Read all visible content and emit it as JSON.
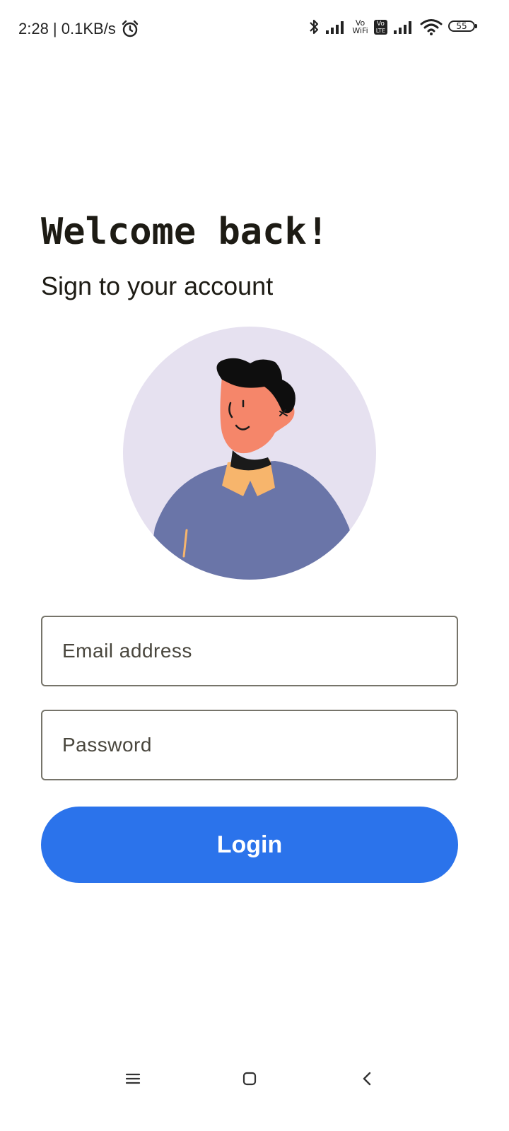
{
  "status_bar": {
    "time_speed": "2:28 | 0.1KB/s",
    "volte_wifi_top": "Vo",
    "volte_wifi_bottom": "WiFi",
    "volte_lte_top": "Vo",
    "volte_lte_bottom": "LTE",
    "battery_level": "55",
    "icons": [
      "alarm-icon",
      "bluetooth-icon",
      "signal-icon",
      "vowifi-icon",
      "volte-icon",
      "signal-icon",
      "wifi-icon",
      "battery-icon"
    ]
  },
  "login": {
    "title": "Welcome back!",
    "subtitle": "Sign to your account",
    "avatar_icon": "user-avatar-illustration",
    "email_placeholder": "Email address",
    "password_placeholder": "Password",
    "login_label": "Login"
  },
  "colors": {
    "accent": "#2b73eb",
    "avatar_bg": "#e6e1f0",
    "shirt": "#6a75a8",
    "skin": "#f5866a",
    "collar": "#f7b56c"
  },
  "nav": {
    "icons": [
      "menu-icon",
      "home-icon",
      "back-icon"
    ]
  }
}
